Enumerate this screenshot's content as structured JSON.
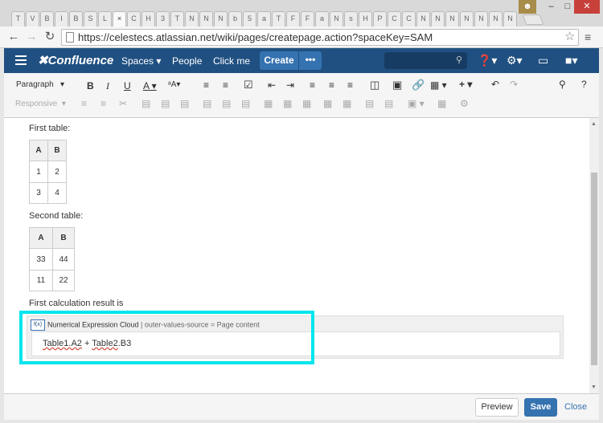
{
  "browser": {
    "tabs": [
      "T",
      "V",
      "B",
      "I",
      "B",
      "S",
      "L",
      "",
      "C",
      "H",
      "3",
      "T",
      "N",
      "N",
      "N",
      "b",
      "5",
      "a",
      "T",
      "F",
      "F",
      "a",
      "N",
      "s",
      "H",
      "P",
      "C",
      "C",
      "N",
      "N",
      "N",
      "N",
      "N",
      "N",
      "N"
    ],
    "active_tab_close": "×",
    "url": "https://celestecs.atlassian.net/wiki/pages/createpage.action?spaceKey=SAM"
  },
  "header": {
    "logo": "Confluence",
    "spaces": "Spaces ▾",
    "people": "People",
    "clickme": "Click me",
    "create": "Create",
    "more": "•••"
  },
  "toolbar": {
    "paragraph": "Paragraph",
    "responsive": "Responsive"
  },
  "content": {
    "first_table_label": "First table:",
    "table1": {
      "headers": [
        "A",
        "B"
      ],
      "rows": [
        [
          "1",
          "2"
        ],
        [
          "3",
          "4"
        ]
      ]
    },
    "second_table_label": "Second table:",
    "table2": {
      "headers": [
        "A",
        "B"
      ],
      "rows": [
        [
          "33",
          "44"
        ],
        [
          "11",
          "22"
        ]
      ]
    },
    "calc_label": "First calculation result is",
    "macro": {
      "icon_text": "f(x)",
      "title": "Numerical Expression Cloud",
      "params": " | outer-values-source = Page content",
      "expr_part1": "Table1.A2",
      "expr_plus": " + ",
      "expr_part2": "Table2",
      "expr_part3": ".B3"
    }
  },
  "footer": {
    "preview": "Preview",
    "save": "Save",
    "close": "Close"
  }
}
